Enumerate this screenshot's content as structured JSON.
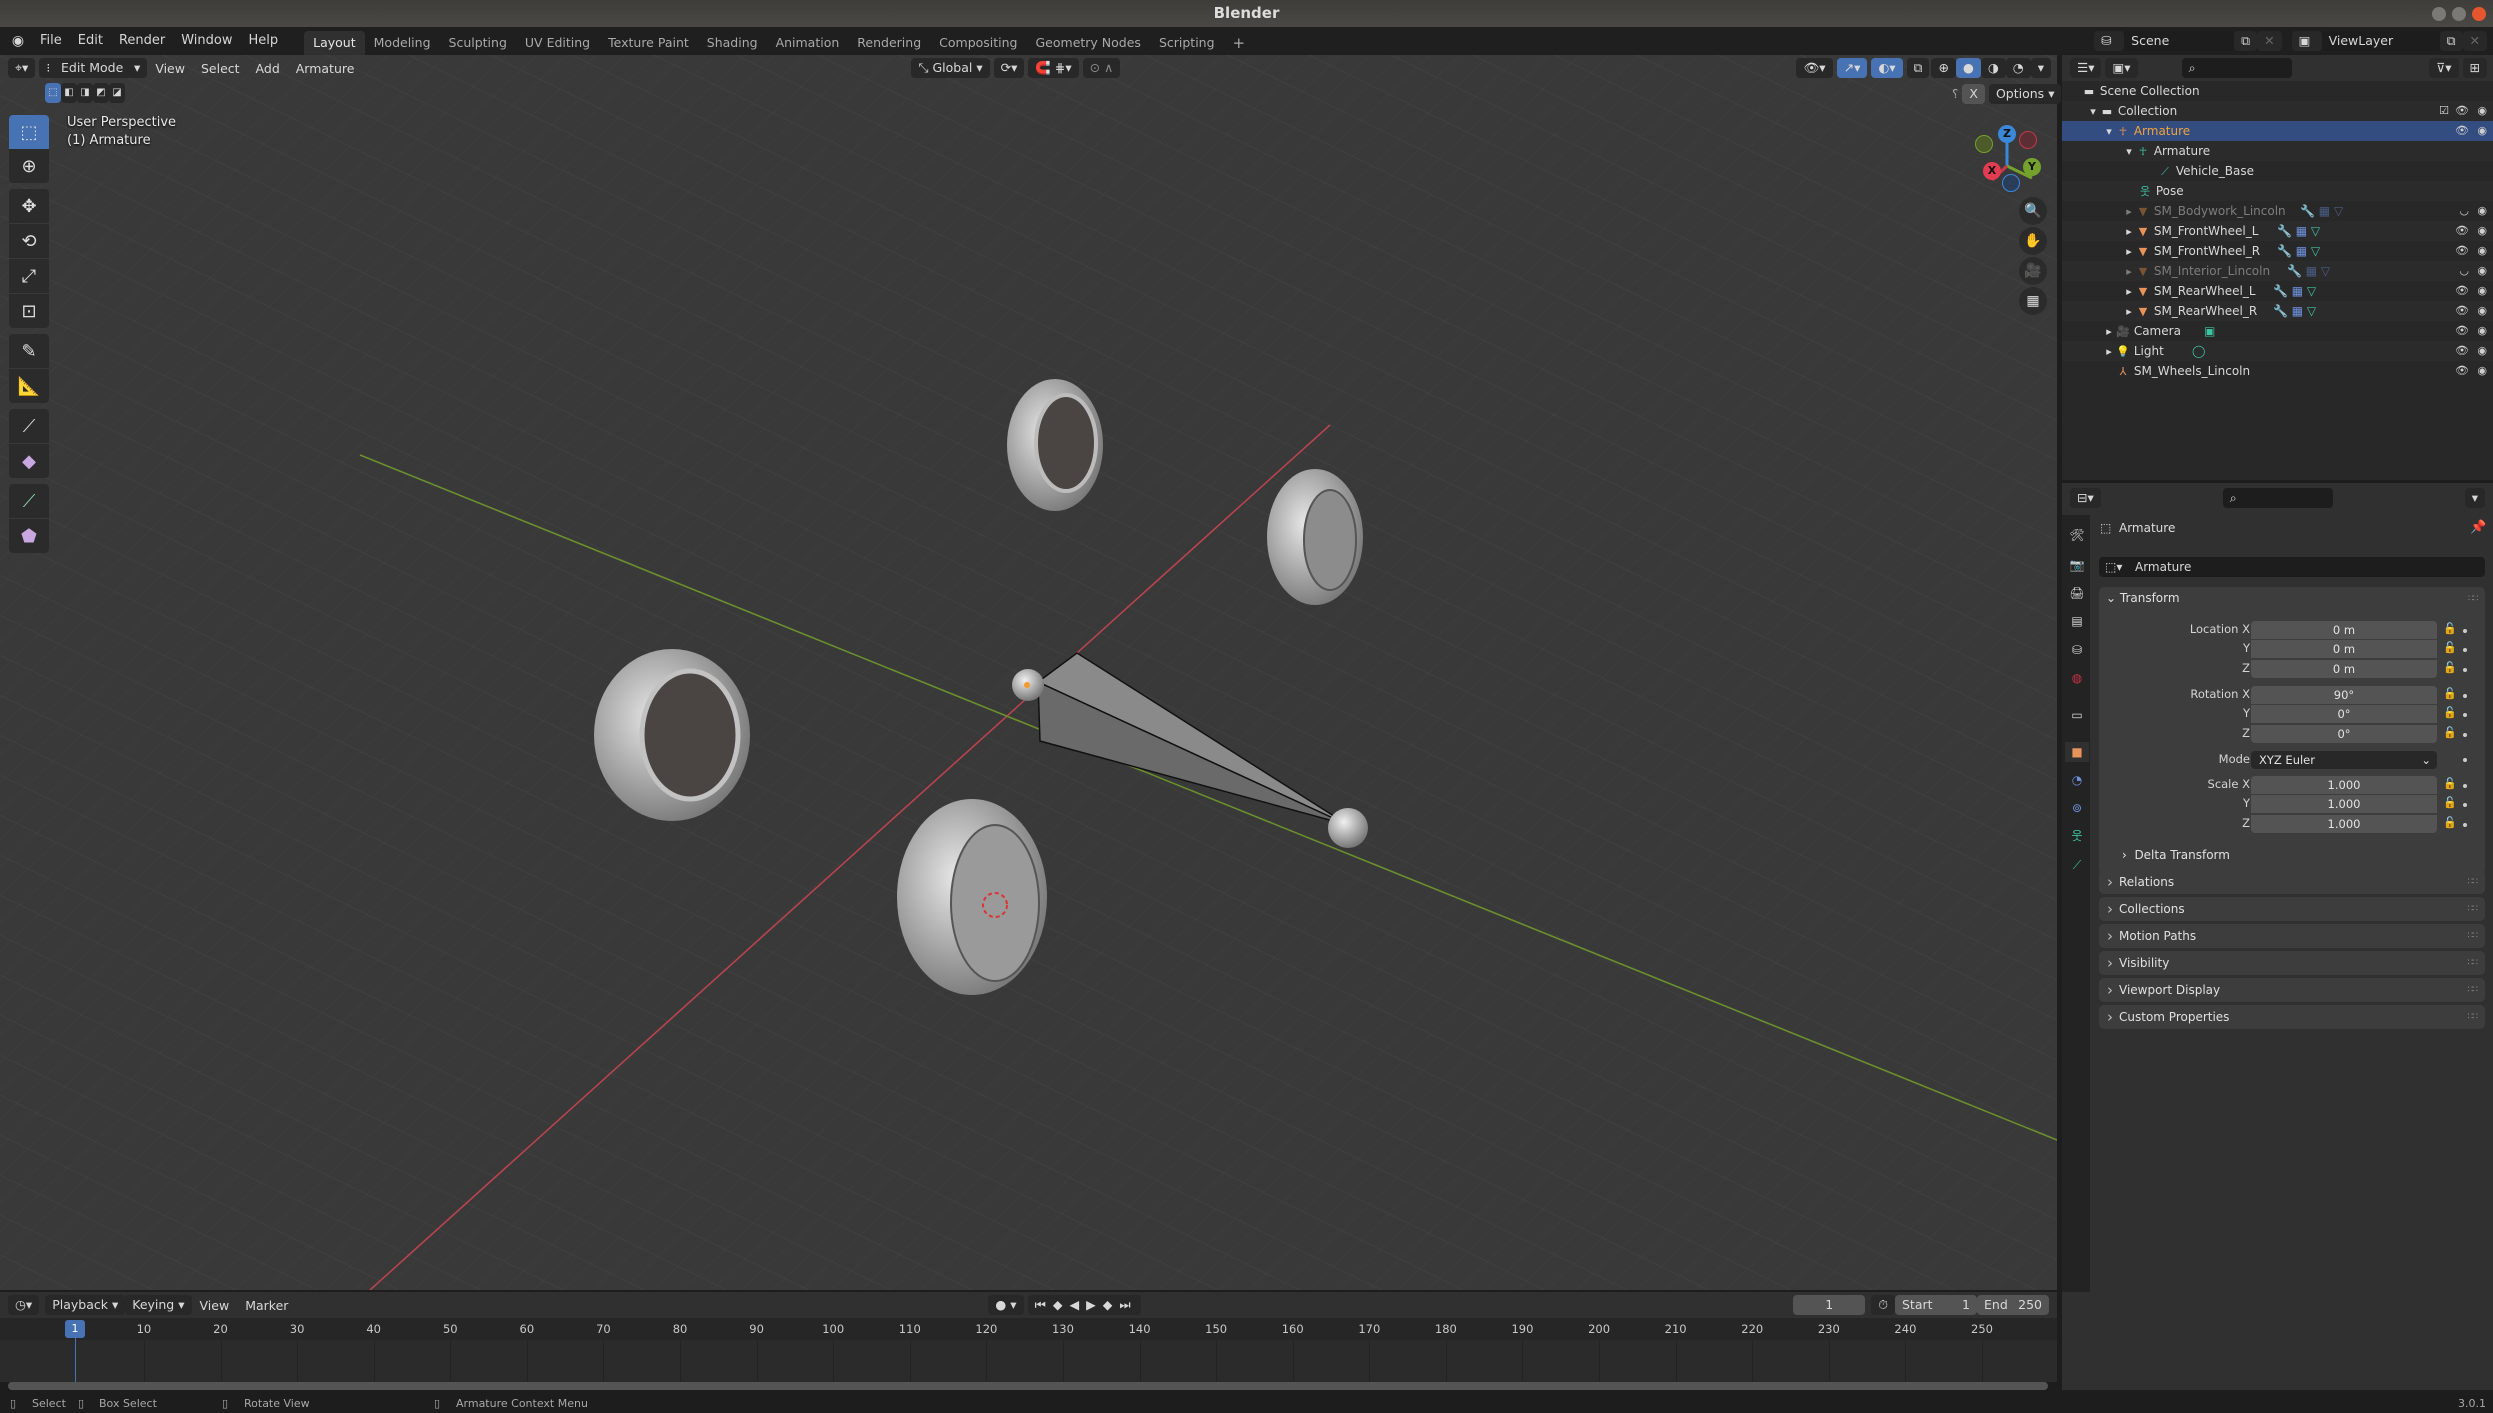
{
  "window": {
    "title": "Blender"
  },
  "topbar": {
    "menus": [
      "File",
      "Edit",
      "Render",
      "Window",
      "Help"
    ],
    "workspaces": [
      "Layout",
      "Modeling",
      "Sculpting",
      "UV Editing",
      "Texture Paint",
      "Shading",
      "Animation",
      "Rendering",
      "Compositing",
      "Geometry Nodes",
      "Scripting"
    ],
    "active_workspace": "Layout",
    "add_workspace": "+",
    "scene": "Scene",
    "view_layer": "ViewLayer"
  },
  "viewport": {
    "mode": "Edit Mode",
    "menus": [
      "View",
      "Select",
      "Add",
      "Armature"
    ],
    "transform_orientation": "Global",
    "options_label": "Options",
    "mirror_x": "X",
    "overlay_line1": "User Perspective",
    "overlay_line2": "(1) Armature",
    "gizmo": {
      "z": "Z",
      "y": "Y",
      "x": "X"
    },
    "colors": {
      "x_axis": "#c6394a",
      "y_axis": "#74a22c",
      "z_axis": "#3b88d8",
      "active": "#4772b3"
    },
    "tools": [
      "select-box",
      "cursor",
      "move",
      "rotate",
      "scale",
      "transform",
      "annotate",
      "measure",
      "extrude",
      "extrude-to-cursor",
      "roll",
      "bone-size"
    ]
  },
  "outliner": {
    "rows": [
      {
        "label": "Scene Collection",
        "icon": "collection-icon",
        "depth": 0
      },
      {
        "label": "Collection",
        "icon": "collection-icon",
        "depth": 1,
        "checked": true
      },
      {
        "label": "Armature",
        "icon": "armature-object-icon",
        "depth": 2,
        "selected": true
      },
      {
        "label": "Armature",
        "icon": "armature-data-icon",
        "depth": 3
      },
      {
        "label": "Vehicle_Base",
        "icon": "bone-icon",
        "depth": 4
      },
      {
        "label": "Pose",
        "icon": "pose-icon",
        "depth": 3
      },
      {
        "label": "SM_Bodywork_Lincoln",
        "icon": "mesh-icon",
        "depth": 3,
        "hidden": true
      },
      {
        "label": "SM_FrontWheel_L",
        "icon": "mesh-icon",
        "depth": 3
      },
      {
        "label": "SM_FrontWheel_R",
        "icon": "mesh-icon",
        "depth": 3
      },
      {
        "label": "SM_Interior_Lincoln",
        "icon": "mesh-icon",
        "depth": 3,
        "hidden": true
      },
      {
        "label": "SM_RearWheel_L",
        "icon": "mesh-icon",
        "depth": 3
      },
      {
        "label": "SM_RearWheel_R",
        "icon": "mesh-icon",
        "depth": 3
      },
      {
        "label": "Camera",
        "icon": "camera-icon",
        "depth": 2
      },
      {
        "label": "Light",
        "icon": "light-icon",
        "depth": 2
      },
      {
        "label": "SM_Wheels_Lincoln",
        "icon": "empty-icon",
        "depth": 2
      }
    ]
  },
  "properties": {
    "context": "Armature",
    "object_name": "Armature",
    "transform": {
      "title": "Transform",
      "location": {
        "label": "Location X",
        "x": "0 m",
        "y": "0 m",
        "z": "0 m"
      },
      "rotation": {
        "label": "Rotation X",
        "x": "90°",
        "y": "0°",
        "z": "0°"
      },
      "mode_label": "Mode",
      "mode": "XYZ Euler",
      "scale": {
        "label": "Scale X",
        "x": "1.000",
        "y": "1.000",
        "z": "1.000"
      },
      "axis_y": "Y",
      "axis_z": "Z",
      "delta": "Delta Transform"
    },
    "panels": [
      "Relations",
      "Collections",
      "Motion Paths",
      "Visibility",
      "Viewport Display",
      "Custom Properties"
    ]
  },
  "timeline": {
    "menus": [
      "Playback",
      "Keying",
      "View",
      "Marker"
    ],
    "current_frame": "1",
    "start_label": "Start",
    "start": "1",
    "end_label": "End",
    "end": "250",
    "ticks": [
      "10",
      "20",
      "30",
      "40",
      "50",
      "60",
      "70",
      "80",
      "90",
      "100",
      "110",
      "120",
      "130",
      "140",
      "150",
      "160",
      "170",
      "180",
      "190",
      "200",
      "210",
      "220",
      "230",
      "240",
      "250"
    ]
  },
  "status": {
    "items": [
      "Select",
      "Box Select",
      "Rotate View",
      "Armature Context Menu"
    ],
    "version": "3.0.1"
  }
}
